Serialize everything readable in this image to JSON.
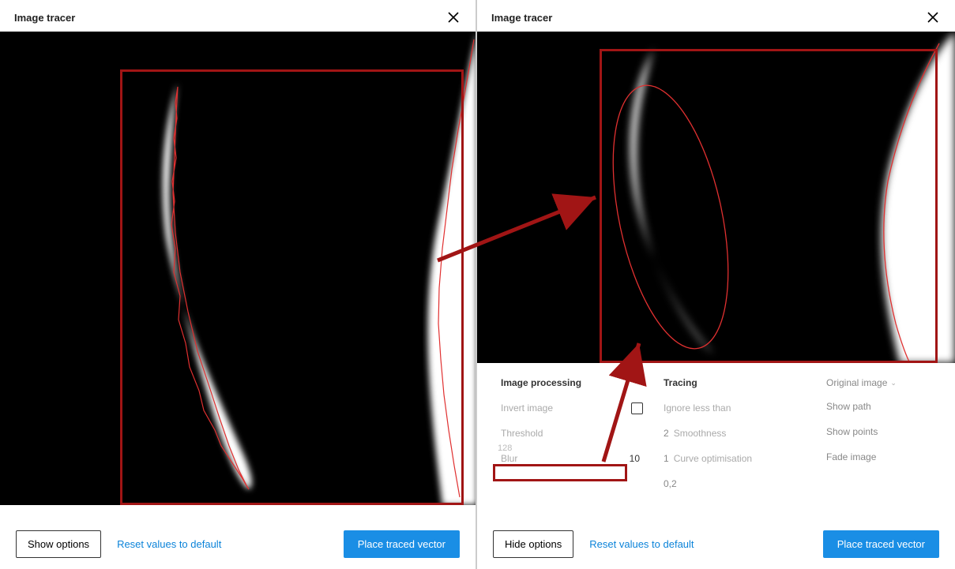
{
  "left": {
    "title": "Image tracer",
    "footer": {
      "options_btn": "Show options",
      "reset": "Reset values to default",
      "place": "Place traced vector"
    }
  },
  "right": {
    "title": "Image tracer",
    "footer": {
      "options_btn": "Hide options",
      "reset": "Reset values to default",
      "place": "Place traced vector"
    },
    "options": {
      "image_processing": {
        "header": "Image processing",
        "invert_label": "Invert image",
        "invert_checked": false,
        "threshold_label": "Threshold",
        "threshold_value": "128",
        "blur_label": "Blur",
        "blur_value": "10"
      },
      "tracing": {
        "header": "Tracing",
        "ignore_label": "Ignore less than",
        "ignore_value": "2",
        "smoothness_label": "Smoothness",
        "smoothness_value": "1",
        "curve_label": "Curve optimisation",
        "curve_value": "0,2"
      },
      "display": {
        "original_label": "Original image",
        "show_path_label": "Show path",
        "show_path_checked": true,
        "show_points_label": "Show points",
        "show_points_checked": true,
        "fade_label": "Fade image",
        "fade_checked": false
      }
    }
  }
}
